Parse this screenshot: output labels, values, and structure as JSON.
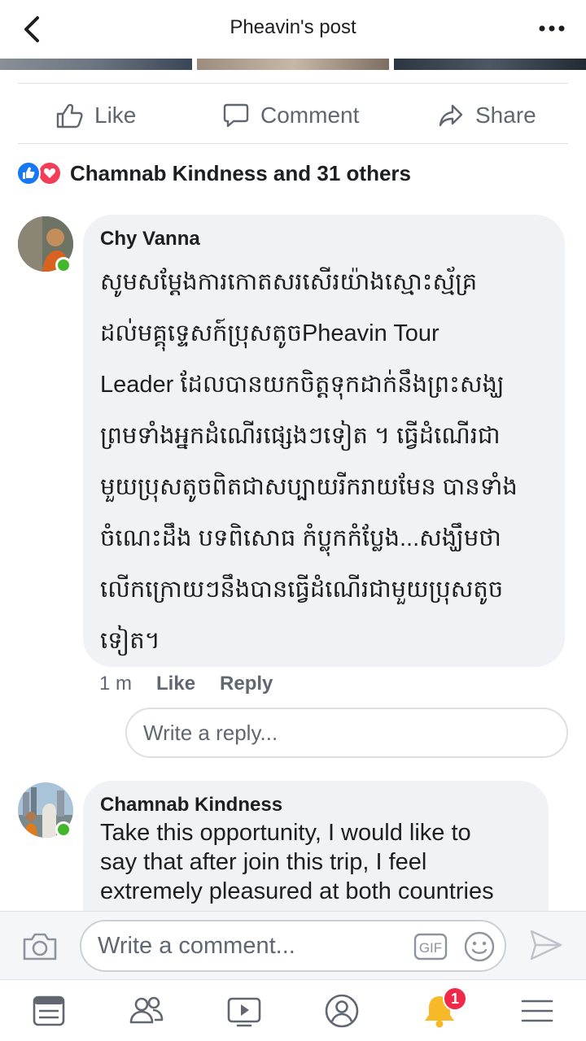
{
  "header": {
    "title": "Pheavin's post",
    "back_icon": "chevron-left-icon",
    "more_icon": "more-dots-icon"
  },
  "actions": {
    "like": "Like",
    "comment": "Comment",
    "share": "Share"
  },
  "reactions": {
    "summary": "Chamnab Kindness and 31 others",
    "icons": [
      "like-reaction-icon",
      "love-reaction-icon"
    ]
  },
  "comments": [
    {
      "author": "Chy Vanna",
      "lines": [
        "សូមសម្ដែងការកោតសរសើរយ៉ាងស្មោះស្ម័គ្រ",
        "ដល់មគ្គុទ្ទេសក៍ប្រុសតូចPheavin Tour",
        "Leader ដែលបានយកចិត្តទុកដាក់នឹងព្រះសង្ឃ",
        "ព្រមទាំងអ្នកដំណើរផ្សេងៗទៀត ។ ធ្វើដំណើរជា",
        "មួយប្រុសតូចពិតជាសប្បាយរីករាយមែន បានទាំង",
        "ចំណេះដឹង បទពិសោធ កំប្លុកកំប្លែង...សង្ឃឹមថា",
        "លើកក្រោយៗនឹងបានធ្វើដំណើរជាមួយប្រុសតូច",
        "ទៀត។"
      ],
      "time": "1 m",
      "like_label": "Like",
      "reply_label": "Reply"
    },
    {
      "author": "Chamnab Kindness",
      "lines": [
        "Take this opportunity, I would like to",
        "say that after join this trip, I feel",
        "extremely pleasured at both countries"
      ]
    }
  ],
  "reply_box": {
    "placeholder": "Write a reply..."
  },
  "composer": {
    "placeholder": "Write a comment...",
    "gif_label": "GIF"
  },
  "nav": {
    "items": [
      "news-feed-icon",
      "friends-icon",
      "watch-icon",
      "profile-icon",
      "notifications-icon",
      "menu-icon"
    ],
    "notification_count": "1"
  },
  "colors": {
    "like_blue": "#1877f2",
    "love_red": "#f33e58",
    "online_green": "#42b72a",
    "badge_red": "#f02849",
    "bell_gold": "#f7b928"
  }
}
